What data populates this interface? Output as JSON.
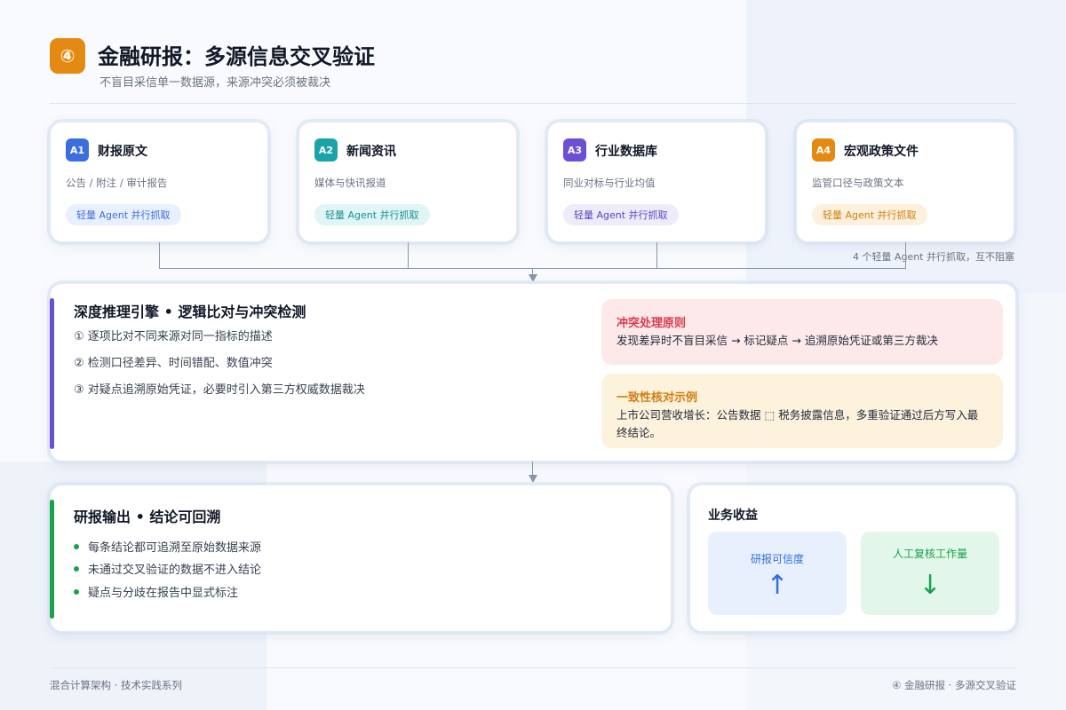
{
  "header": {
    "badge": "④",
    "title": "金融研报：多源信息交叉验证",
    "subtitle": "不盲目采信单一数据源，来源冲突必须被裁决"
  },
  "sources": [
    {
      "tag": "A1",
      "title": "财报原文",
      "desc": "公告 / 附注 / 审计报告",
      "pill": "轻量 Agent 并行抓取",
      "tag_color": "#3b6fe0",
      "pill_bg": "#e8efff",
      "pill_color": "#3b6fe0"
    },
    {
      "tag": "A2",
      "title": "新闻资讯",
      "desc": "媒体与快讯报道",
      "pill": "轻量 Agent 并行抓取",
      "tag_color": "#1aa3a8",
      "pill_bg": "#e0f5f5",
      "pill_color": "#1a8f94"
    },
    {
      "tag": "A3",
      "title": "行业数据库",
      "desc": "同业对标与行业均值",
      "pill": "轻量 Agent 并行抓取",
      "tag_color": "#6b4fd6",
      "pill_bg": "#eeebfb",
      "pill_color": "#5b45c2"
    },
    {
      "tag": "A4",
      "title": "宏观政策文件",
      "desc": "监管口径与政策文本",
      "pill": "轻量 Agent 并行抓取",
      "tag_color": "#e48a12",
      "pill_bg": "#fdf0dc",
      "pill_color": "#d27d0e"
    }
  ],
  "sources_note": "4 个轻量 Agent 并行抓取，互不阻塞",
  "engine": {
    "title": "深度推理引擎 • 逻辑比对与冲突检测",
    "items": [
      "① 逐项比对不同来源对同一指标的描述",
      "② 检测口径差异、时间错配、数值冲突",
      "③ 对疑点追溯原始凭证，必要时引入第三方权威数据裁决"
    ],
    "accent_color": "#6b4fd6",
    "conflict": {
      "title": "冲突处理原则",
      "text": "发现差异时不盲目采信 → 标记疑点 → 追溯原始凭证或第三方裁决",
      "bg": "#fde9ea",
      "title_color": "#d93a4a"
    },
    "consistency": {
      "title": "一致性核对示例",
      "text": "上市公司营收增长：公告数据 ⬚ 税务披露信息，多重验证通过后方写入最终结论。",
      "bg": "#fdf2dc",
      "title_color": "#d27d0e"
    }
  },
  "output": {
    "title": "研报输出 • 结论可回溯",
    "items": [
      "每条结论都可追溯至原始数据来源",
      "未通过交叉验证的数据不进入结论",
      "疑点与分歧在报告中显式标注"
    ],
    "accent_color": "#16a34a"
  },
  "benefits": {
    "title": "业务收益",
    "items": [
      {
        "label": "研报可信度",
        "arrow": "↑",
        "bg": "#e9f0fd",
        "color": "#2f6fe0"
      },
      {
        "label": "人工复核工作量",
        "arrow": "↓",
        "bg": "#e3f6ea",
        "color": "#16a34a"
      }
    ]
  },
  "footer": {
    "left": "混合计算架构 · 技术实践系列",
    "right": "④ 金融研报 · 多源交叉验证"
  }
}
